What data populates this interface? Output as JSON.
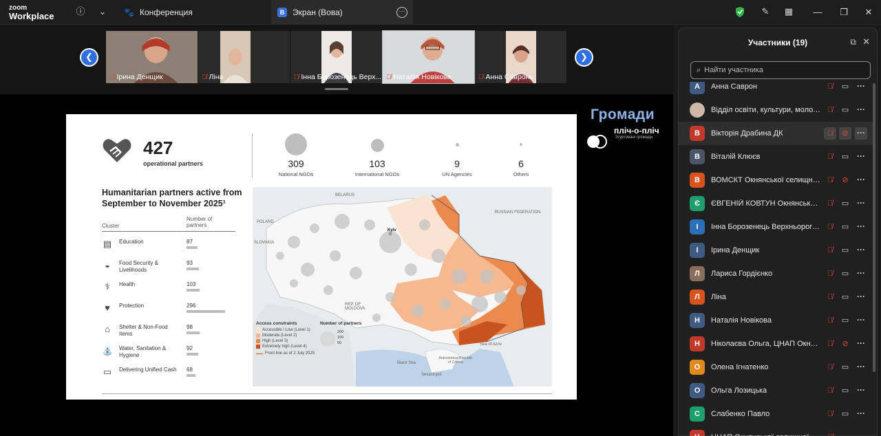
{
  "app": {
    "brand_top": "zoom",
    "brand_bottom": "Workplace"
  },
  "tabs": {
    "conference": "Конференция",
    "screen": "Экран (Вова)",
    "screen_badge": "В"
  },
  "colors": {
    "accent": "#2f6fe0",
    "muted_red": "#e0463c",
    "security_green": "#2fb344"
  },
  "thumbnails": [
    {
      "name": "Ірина Денщик"
    },
    {
      "name": "Ліна"
    },
    {
      "name": "Інна Борозенець Верх..."
    },
    {
      "name": "Наталія Новікова"
    },
    {
      "name": "Анна Савронь"
    }
  ],
  "overlay": {
    "title": "Громади",
    "subtitle": "пліч-о-пліч",
    "tagline": "Згуртовані громади"
  },
  "slide": {
    "total": "427",
    "total_label": "operational partners",
    "stats": [
      {
        "value": "309",
        "label": "National NGOs"
      },
      {
        "value": "103",
        "label": "International NGOs"
      },
      {
        "value": "9",
        "label": "UN Agencies"
      },
      {
        "value": "6",
        "label": "Others"
      }
    ],
    "title": "Humanitarian partners active from September to November 2025¹",
    "col_cluster": "Cluster",
    "col_partners": "Number of partners",
    "clusters": [
      {
        "label": "Education",
        "value": "87",
        "icon": "book-icon"
      },
      {
        "label": "Food Security & Livelihoods",
        "value": "93",
        "icon": "bowl-icon"
      },
      {
        "label": "Health",
        "value": "103",
        "icon": "health-icon"
      },
      {
        "label": "Protection",
        "value": "296",
        "icon": "protection-icon"
      },
      {
        "label": "Shelter & Non-Food Items",
        "value": "98",
        "icon": "shelter-icon"
      },
      {
        "label": "Water, Sanitation & Hygiene",
        "value": "92",
        "icon": "water-icon"
      },
      {
        "label": "Delivering Unified Cash",
        "value": "68",
        "icon": "cash-icon"
      }
    ],
    "map": {
      "labels": [
        "BELARUS",
        "POLAND",
        "SLOVAKIA",
        "RUSSIAN FEDERATION",
        "REP. OF MOLDOVA",
        "Kyiv",
        "Black Sea",
        "Sea of Azov",
        "Autonomous Republic of Crimea",
        "Sevastopol"
      ],
      "legend_title": "Access constraints",
      "legend_items": [
        {
          "label": "Accessible / Low (Level 1)",
          "color": "#fbe3d2"
        },
        {
          "label": "Moderate (Level 2)",
          "color": "#f6b98f"
        },
        {
          "label": "High (Level 3)",
          "color": "#ec8a4e"
        },
        {
          "label": "Extremely high (Level 4)",
          "color": "#c8531f"
        }
      ],
      "front_line": "Front line as of 2 July 2025",
      "size_legend_title": "Number of partners",
      "size_legend_values": [
        "200",
        "100",
        "50"
      ]
    }
  },
  "panel": {
    "title": "Участники (19)",
    "search_placeholder": "Найти участника",
    "participants": [
      {
        "name": "Анна Саврон",
        "initial": "А",
        "color": "#3f5b83",
        "cam_off": false
      },
      {
        "name": "Відділ освіти, культури, молоді ...",
        "initial": "",
        "color": "#8a7060",
        "cam_off": false,
        "photo": true
      },
      {
        "name": "Вікторія Драбина ДК",
        "initial": "В",
        "color": "#c0392b",
        "cam_off": true,
        "highlight": true
      },
      {
        "name": "Віталій Клюєв",
        "initial": "В",
        "color": "#4a5568",
        "cam_off": false
      },
      {
        "name": "ВОМСКТ Окнянської селищної ...",
        "initial": "В",
        "color": "#d9531e",
        "cam_off": true
      },
      {
        "name": "ЄВГЕНІЙ КОВТУН Окнянська се...",
        "initial": "Є",
        "color": "#1e9e6a",
        "cam_off": false
      },
      {
        "name": "Інна Борозенець Верхньорогач...",
        "initial": "І",
        "color": "#2a6fb8",
        "cam_off": false
      },
      {
        "name": "Ірина Денщик",
        "initial": "І",
        "color": "#3f5b83",
        "cam_off": false
      },
      {
        "name": "Лариса Гордієнко",
        "initial": "Л",
        "color": "#8a6e5c",
        "cam_off": false
      },
      {
        "name": "Ліна",
        "initial": "Л",
        "color": "#d9531e",
        "cam_off": false
      },
      {
        "name": "Наталія Новікова",
        "initial": "Н",
        "color": "#3f5b83",
        "cam_off": false
      },
      {
        "name": "Ніколаєва Ольга, ЦНАП Окнянс...",
        "initial": "Н",
        "color": "#c0392b",
        "cam_off": true
      },
      {
        "name": "Олена Ігнатенко",
        "initial": "О",
        "color": "#e08a1e",
        "cam_off": false
      },
      {
        "name": "Ольга Лозицька",
        "initial": "О",
        "color": "#3f5b83",
        "cam_off": false
      },
      {
        "name": "Слабенко Павло",
        "initial": "С",
        "color": "#1e9e6a",
        "cam_off": false
      },
      {
        "name": "ЦНАП Окнянської селищної ра...",
        "initial": "Ц",
        "color": "#c0392b",
        "cam_off": false
      }
    ]
  }
}
